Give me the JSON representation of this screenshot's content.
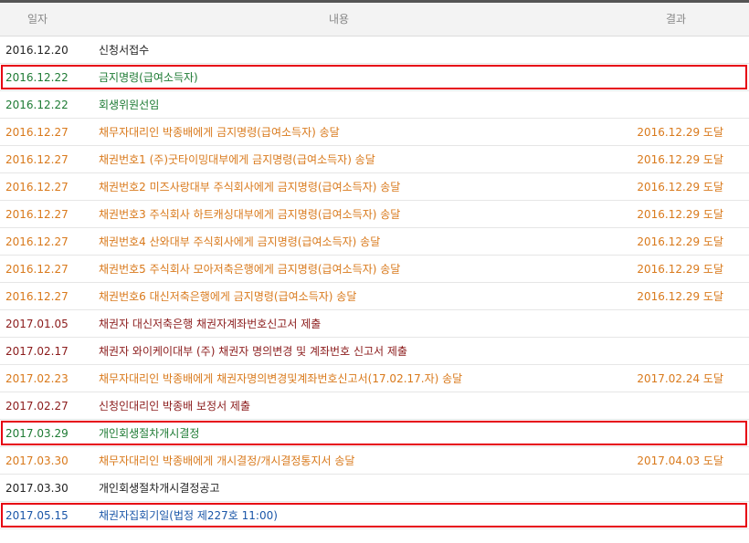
{
  "header": {
    "date": "일자",
    "content": "내용",
    "result": "결과"
  },
  "rows": [
    {
      "date": "2016.12.20",
      "content": "신청서접수",
      "result": "",
      "color": "black",
      "highlight": false
    },
    {
      "date": "2016.12.22",
      "content": "금지명령(급여소득자)",
      "result": "",
      "color": "green",
      "highlight": true
    },
    {
      "date": "2016.12.22",
      "content": "회생위원선임",
      "result": "",
      "color": "green",
      "highlight": false
    },
    {
      "date": "2016.12.27",
      "content": "채무자대리인 박종배에게 금지명령(급여소득자) 송달",
      "result": "2016.12.29 도달",
      "color": "orange",
      "highlight": false
    },
    {
      "date": "2016.12.27",
      "content": "채권번호1 (주)굿타이밍대부에게 금지명령(급여소득자) 송달",
      "result": "2016.12.29 도달",
      "color": "orange",
      "highlight": false
    },
    {
      "date": "2016.12.27",
      "content": "채권번호2 미즈사랑대부 주식회사에게 금지명령(급여소득자) 송달",
      "result": "2016.12.29 도달",
      "color": "orange",
      "highlight": false
    },
    {
      "date": "2016.12.27",
      "content": "채권번호3 주식회사 하트캐싱대부에게 금지명령(급여소득자) 송달",
      "result": "2016.12.29 도달",
      "color": "orange",
      "highlight": false
    },
    {
      "date": "2016.12.27",
      "content": "채권번호4 산와대부 주식회사에게 금지명령(급여소득자) 송달",
      "result": "2016.12.29 도달",
      "color": "orange",
      "highlight": false
    },
    {
      "date": "2016.12.27",
      "content": "채권번호5 주식회사 모아저축은행에게 금지명령(급여소득자) 송달",
      "result": "2016.12.29 도달",
      "color": "orange",
      "highlight": false
    },
    {
      "date": "2016.12.27",
      "content": "채권번호6 대신저축은행에게 금지명령(급여소득자) 송달",
      "result": "2016.12.29 도달",
      "color": "orange",
      "highlight": false
    },
    {
      "date": "2017.01.05",
      "content": "채권자 대신저축은행 채권자계좌번호신고서 제출",
      "result": "",
      "color": "maroon",
      "highlight": false
    },
    {
      "date": "2017.02.17",
      "content": "채권자 와이케이대부 (주) 채권자 명의변경 및 계좌번호 신고서 제출",
      "result": "",
      "color": "maroon",
      "highlight": false
    },
    {
      "date": "2017.02.23",
      "content": "채무자대리인 박종배에게 채권자명의변경및계좌번호신고서(17.02.17.자) 송달",
      "result": "2017.02.24 도달",
      "color": "orange",
      "highlight": false
    },
    {
      "date": "2017.02.27",
      "content": "신청인대리인 박종배 보정서 제출",
      "result": "",
      "color": "maroon",
      "highlight": false
    },
    {
      "date": "2017.03.29",
      "content": "개인회생절차개시결정",
      "result": "",
      "color": "green",
      "highlight": true
    },
    {
      "date": "2017.03.30",
      "content": "채무자대리인 박종배에게 개시결정/개시결정통지서 송달",
      "result": "2017.04.03 도달",
      "color": "orange",
      "highlight": false
    },
    {
      "date": "2017.03.30",
      "content": "개인회생절차개시결정공고",
      "result": "",
      "color": "black",
      "highlight": false
    },
    {
      "date": "2017.05.15",
      "content": "채권자집회기일(법정 제227호 11:00)",
      "result": "",
      "color": "blue",
      "highlight": true
    }
  ]
}
